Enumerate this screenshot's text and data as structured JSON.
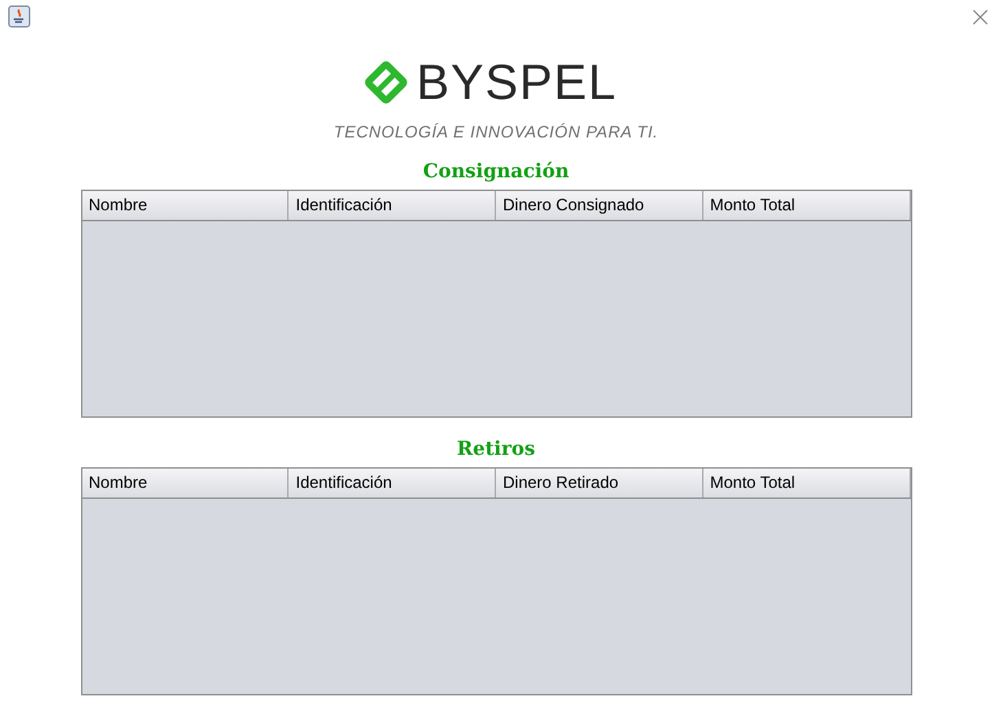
{
  "logo": {
    "name": "BYSPEL",
    "tagline": "TECNOLOGÍA E INNOVACIÓN PARA TI."
  },
  "tables": [
    {
      "title": "Consignación",
      "columns": [
        "Nombre",
        "Identificación",
        "Dinero Consignado",
        "Monto Total"
      ]
    },
    {
      "title": "Retiros",
      "columns": [
        "Nombre",
        "Identificación",
        "Dinero Retirado",
        "Monto Total"
      ]
    }
  ]
}
